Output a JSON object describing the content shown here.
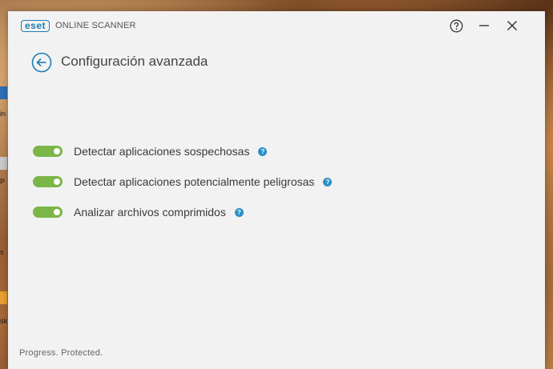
{
  "desktop": {
    "fragments": [
      "in",
      "P",
      "s",
      "sk"
    ]
  },
  "window": {
    "brand_badge": "eset",
    "brand_product": "ONLINE SCANNER",
    "title": "Configuración avanzada",
    "options": [
      {
        "label": "Detectar aplicaciones sospechosas",
        "enabled": true
      },
      {
        "label": "Detectar aplicaciones potencialmente peligrosas",
        "enabled": true
      },
      {
        "label": "Analizar archivos comprimidos",
        "enabled": true
      }
    ],
    "help_glyph": "?",
    "footer": "Progress. Protected."
  },
  "colors": {
    "accent": "#1a7db5",
    "toggle_on": "#7ab648",
    "help": "#2a8fc9"
  }
}
